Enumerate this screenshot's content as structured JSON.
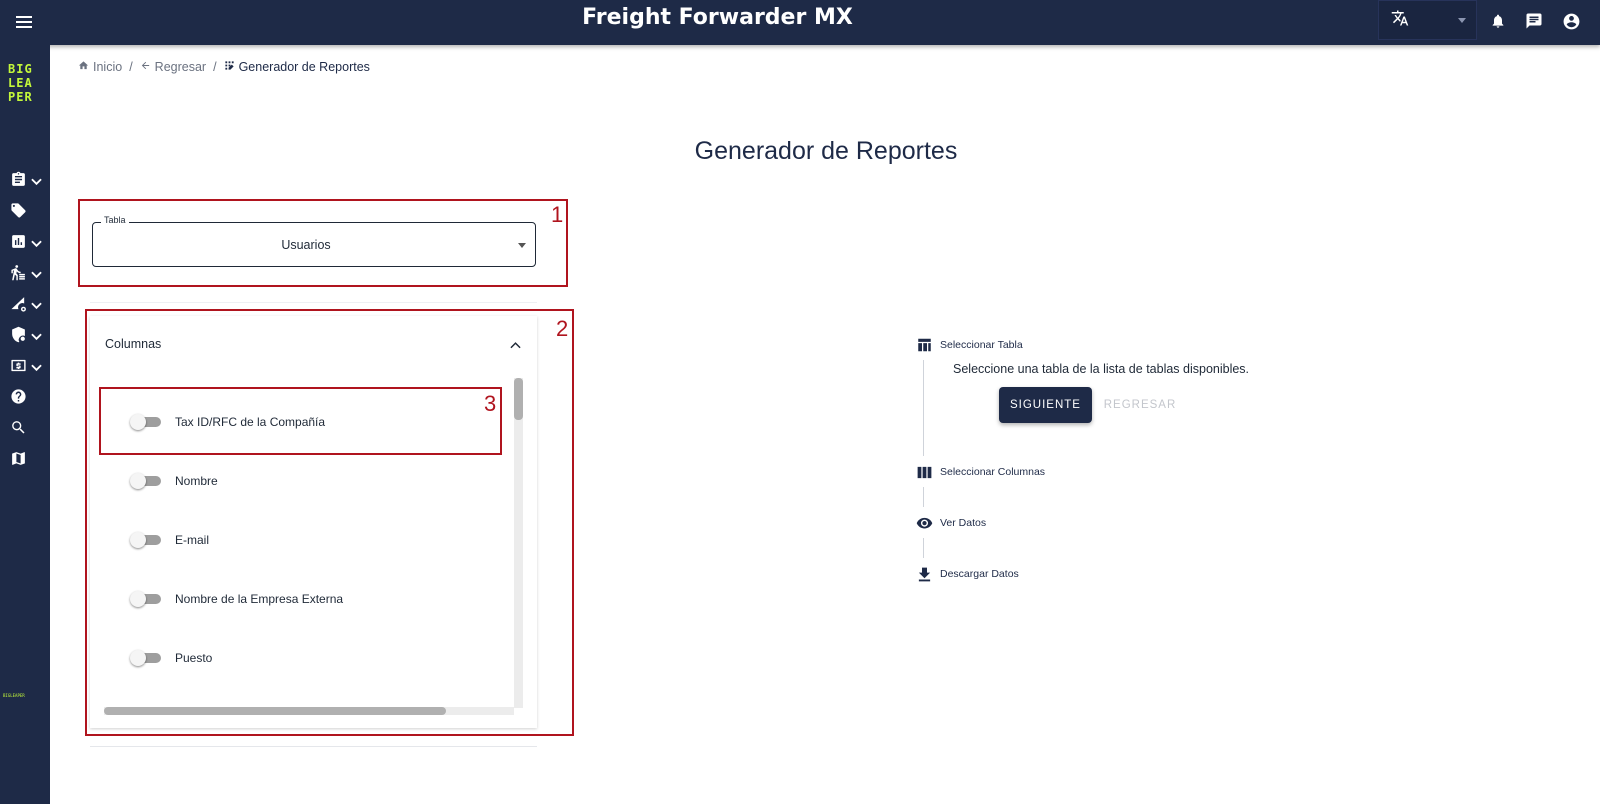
{
  "app": {
    "title": "Freight Forwarder MX"
  },
  "header": {
    "language_icon": "translate-icon",
    "notifications_icon": "bell-icon",
    "messages_icon": "chat-icon",
    "account_icon": "account-circle-icon"
  },
  "sidebar": {
    "logo_lines": [
      "BIG",
      "LEA",
      "PER"
    ],
    "mini_logo": "BIGLEAPER",
    "items": [
      {
        "icon": "clipboard-icon",
        "has_submenu": true
      },
      {
        "icon": "tag-icon",
        "has_submenu": false
      },
      {
        "icon": "bar-chart-icon",
        "has_submenu": true
      },
      {
        "icon": "person-walking-icon",
        "has_submenu": true
      },
      {
        "icon": "shipping-settings-icon",
        "has_submenu": true
      },
      {
        "icon": "shield-icon",
        "has_submenu": true
      },
      {
        "icon": "money-icon",
        "has_submenu": true
      },
      {
        "icon": "help-icon",
        "has_submenu": false
      },
      {
        "icon": "search-icon",
        "has_submenu": false
      },
      {
        "icon": "map-icon",
        "has_submenu": false
      }
    ]
  },
  "breadcrumb": {
    "home": "Inicio",
    "back": "Regresar",
    "current": "Generador de Reportes"
  },
  "page": {
    "title": "Generador de Reportes"
  },
  "table_select": {
    "label": "Tabla",
    "value": "Usuarios"
  },
  "columns_panel": {
    "title": "Columnas",
    "items": [
      {
        "label": "Tax ID/RFC de la Compañía",
        "checked": false
      },
      {
        "label": "Nombre",
        "checked": false
      },
      {
        "label": "E-mail",
        "checked": false
      },
      {
        "label": "Nombre de la Empresa Externa",
        "checked": false
      },
      {
        "label": "Puesto",
        "checked": false
      }
    ]
  },
  "annotations": [
    "1",
    "2",
    "3"
  ],
  "stepper": {
    "steps": [
      {
        "label": "Seleccionar Tabla",
        "icon": "table-icon"
      },
      {
        "label": "Seleccionar Columnas",
        "icon": "columns-icon"
      },
      {
        "label": "Ver Datos",
        "icon": "eye-icon"
      },
      {
        "label": "Descargar Datos",
        "icon": "download-icon"
      }
    ],
    "active_description": "Seleccione una tabla de la lista de tablas disponibles.",
    "next_label": "SIGUIENTE",
    "back_label": "REGRESAR"
  },
  "colors": {
    "navy": "#1e2a47",
    "accent": "#c3f73a",
    "annotation": "#b0141e"
  }
}
